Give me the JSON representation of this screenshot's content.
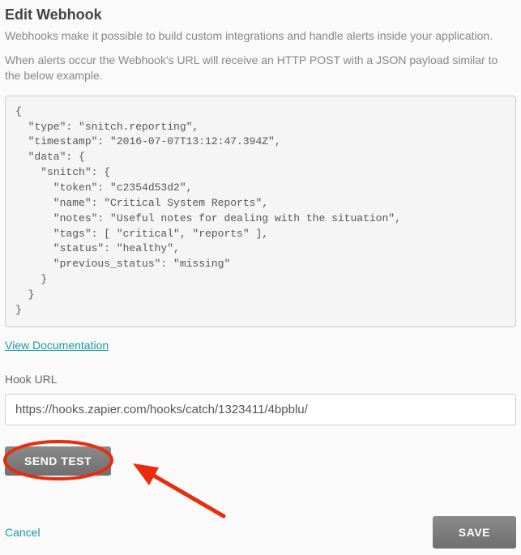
{
  "title": "Edit Webhook",
  "subtitle": "Webhooks make it possible to build custom integrations and handle alerts inside your application.",
  "description": "When alerts occur the Webhook's URL will receive an HTTP POST with a JSON payload similar to the below example.",
  "payload_example": "{\n  \"type\": \"snitch.reporting\",\n  \"timestamp\": \"2016-07-07T13:12:47.394Z\",\n  \"data\": {\n    \"snitch\": {\n      \"token\": \"c2354d53d2\",\n      \"name\": \"Critical System Reports\",\n      \"notes\": \"Useful notes for dealing with the situation\",\n      \"tags\": [ \"critical\", \"reports\" ],\n      \"status\": \"healthy\",\n      \"previous_status\": \"missing\"\n    }\n  }\n}",
  "doc_link_label": "View Documentation",
  "hook_url": {
    "label": "Hook URL",
    "value": "https://hooks.zapier.com/hooks/catch/1323411/4bpblu/"
  },
  "buttons": {
    "send_test": "SEND TEST",
    "cancel": "Cancel",
    "save": "SAVE"
  },
  "annotation": {
    "color": "#e82c0c"
  }
}
